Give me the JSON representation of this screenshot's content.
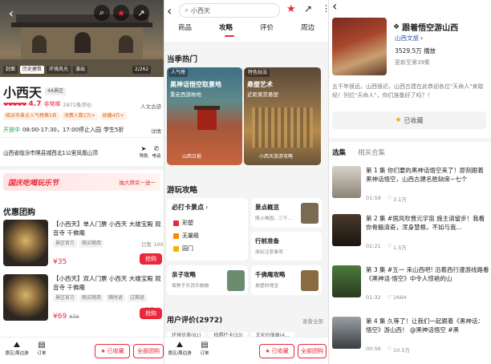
{
  "p1": {
    "photo_tags": [
      "封面",
      "历史建筑",
      "环境风光",
      "演出"
    ],
    "photo_count": "2/262",
    "title": "小西天",
    "level": "4A景区",
    "score": "4.7",
    "score_word": "非常棒",
    "review_count": "2972条评价",
    "tag_right": "人文古迹",
    "rank1": "临汾市景点人气榜第1名",
    "rank2": "消费人数1万+",
    "rank3": "收藏4万+",
    "open_status": "开放中",
    "hours": "08:00-17:30，17:00停止入园",
    "ticket_tag": "学生5折",
    "detail": "详情",
    "address": "山西省临汾市隰县城西北1公里凤凰山顶",
    "nav": "导航",
    "call": "电话",
    "promo": "国庆吃喝玩乐节",
    "promo_sub": "抽大牌买一送一",
    "section": "优惠团购",
    "deals": [
      {
        "name": "【小西天】单人门票 小西天 大雄宝殿 观音寺 千佛庵",
        "tags": [
          "景区官方",
          "随买随用"
        ],
        "sold": "已售 100",
        "price": "¥35",
        "orig": "",
        "btn": "抢购"
      },
      {
        "name": "【小西天】双人门票 小西天 大雄宝殿 观音寺 千佛庵",
        "tags": [
          "景区官方",
          "随买随用",
          "随时退",
          "过期退"
        ],
        "sold": "已售 8",
        "price": "¥69",
        "orig": "¥70",
        "btn": "抢购"
      }
    ],
    "bottom_left1": "景区/周边游",
    "bottom_left2": "订单",
    "fav_btn": "已收藏",
    "all_btn": "全部团购"
  },
  "p2": {
    "search_value": "小西天",
    "tabs": [
      "商品",
      "攻略",
      "评价",
      "周边"
    ],
    "season_title": "当季热门",
    "card1_badge": "人气榜",
    "card1_title": "黑神话悟空取景地",
    "card1_sub": "重走西游故地",
    "card1_foot": "山西日报",
    "card2_badge": "特色玩法",
    "card2_title": "悬塑艺术",
    "card2_sub": "近距离赏悬塑",
    "card2_foot": "小西天旅游攻略",
    "guide_title": "游玩攻略",
    "must_title": "必打卡景点",
    "must_items": [
      "彩塑",
      "无量殿",
      "园门"
    ],
    "g1_title": "景点概览",
    "g1_sub": "随上佛国、三千...",
    "g2_title": "行前准备",
    "g2_sub": "游玩注意事项",
    "g3_title": "亲子攻略",
    "g3_sub": "寓教于乐其乐融融",
    "g4_title": "千佛庵攻略",
    "g4_sub": "悬塑的瑰宝",
    "reviews_title": "用户评价(2972)",
    "reviews_all": "查看全部",
    "review_chips": [
      "环境优美(61)",
      "拍照打卡(33)",
      "文化价值高(4..."
    ],
    "bottom_left1": "景区/周边游",
    "bottom_left2": "订单",
    "fav_btn": "已收藏",
    "all_btn": "全部团购"
  },
  "p3": {
    "album_title": "跟着悟空游山西",
    "publisher": "山西文旅",
    "plays": "3529.5万 播放",
    "updated": "更新至第39集",
    "desc": "五千年很远，山西很近，山西古建在此恭迎各位\"天命人\"来取经！列位\"天命人\"，你们准备好了吗？！",
    "fav": "已收藏",
    "tab_active": "选集",
    "tab2": "相关合集",
    "episodes": [
      {
        "title": "第 1 集  你们要的黑神话悟空来了！即刻跟着黑神话悟空，山西古建名胜缺席~七个",
        "dur": "01:59",
        "likes": "3.1万"
      },
      {
        "title": "第 2 集  #国风吹晋元宇宙 施主请留步！我看你骨骼清奇，浑身慧根，不如与我...",
        "dur": "02:21",
        "likes": "1.5万"
      },
      {
        "title": "第 3 集  #五一 来山西吧! 沿着西行漫游线路看《黑神话·悟空》中令人惊艳的山",
        "dur": "01:32",
        "likes": "2664"
      },
      {
        "title": "第 4 集  久等了！让我们一起跟着《黑神话：悟空》游山西！ @黑神话悟空 #黑",
        "dur": "00:56",
        "likes": "10.5万"
      }
    ]
  },
  "colors": {
    "accent": "#e8283b",
    "orange": "#ff6a00",
    "green": "#1aa34a"
  }
}
